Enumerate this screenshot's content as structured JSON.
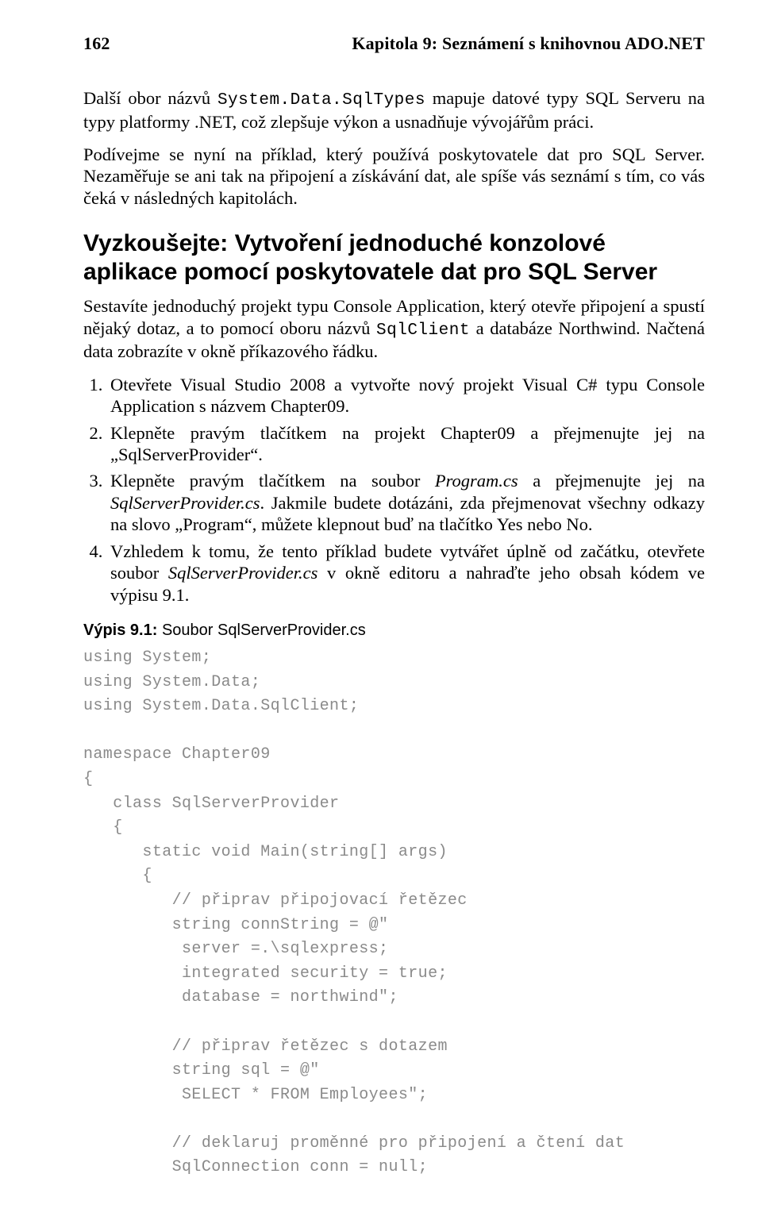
{
  "header": {
    "page_number": "162",
    "chapter_title": "Kapitola 9: Seznámení s knihovnou ADO.NET"
  },
  "para1_pre": "Další obor názvů ",
  "para1_code": "System.Data.SqlTypes",
  "para1_post": " mapuje datové typy SQL Serveru na typy platformy .NET, což zlepšuje výkon a usnadňuje vývojářům práci.",
  "para2": "Podívejme se nyní na příklad, který používá poskytovatele dat pro SQL Server. Nezaměřuje se ani tak na připojení a získávání dat, ale spíše vás seznámí s tím, co vás čeká v následných kapitolách.",
  "tryit_heading": "Vyzkoušejte: Vytvoření jednoduché konzolové aplikace pomocí poskytovatele dat pro SQL Server",
  "para3_pre": "Sestavíte jednoduchý projekt typu Console Application, který otevře připojení a spustí nějaký dotaz, a to pomocí oboru názvů ",
  "para3_code": "SqlClient",
  "para3_post": " a databáze Northwind. Načtená data zobrazíte v okně příkazového řádku.",
  "steps": {
    "s1": "Otevřete Visual Studio 2008 a vytvořte nový projekt Visual C# typu Console Application s názvem Chapter09.",
    "s2": "Klepněte pravým tlačítkem na projekt Chapter09 a přejmenujte jej na „SqlServerProvider“.",
    "s3_a": "Klepněte pravým tlačítkem na soubor ",
    "s3_it1": "Program.cs",
    "s3_b": " a přejmenujte jej na ",
    "s3_it2": "SqlServerProvider.cs",
    "s3_c": ". Jakmile budete dotázáni, zda přejmenovat všechny odkazy na slovo „Program“, můžete klepnout buď na tlačítko Yes nebo No.",
    "s4_a": "Vzhledem k tomu, že tento příklad budete vytvářet úplně od začátku, otevřete soubor ",
    "s4_it1": "SqlServerProvider.cs",
    "s4_b": " v okně editoru a nahraďte jeho obsah kódem ve výpisu 9.1."
  },
  "listing": {
    "label": "Výpis 9.1:",
    "caption": " Soubor SqlServerProvider.cs",
    "code": "using System;\nusing System.Data;\nusing System.Data.SqlClient;\n\nnamespace Chapter09\n{\n   class SqlServerProvider\n   {\n      static void Main(string[] args)\n      {\n         // připrav připojovací řetězec\n         string connString = @\"\n          server =.\\sqlexpress;\n          integrated security = true;\n          database = northwind\";\n\n         // připrav řetězec s dotazem\n         string sql = @\"\n          SELECT * FROM Employees\";\n\n         // deklaruj proměnné pro připojení a čtení dat\n         SqlConnection conn = null;"
  }
}
